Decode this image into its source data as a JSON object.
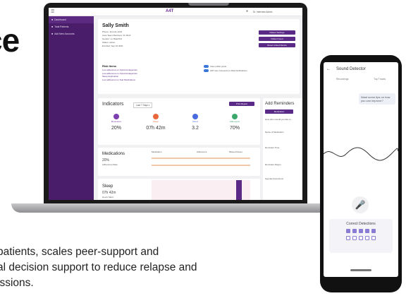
{
  "hero": {
    "text": "ce"
  },
  "tagline": {
    "line1": "patients, scales peer-support and",
    "line2": "al decision support to reduce relapse and",
    "line3": "issions."
  },
  "laptop": {
    "app_logo": "A4T",
    "user_label": "Dr. Interview Admin",
    "sidebar": {
      "items": [
        {
          "label": "Dashboard",
          "active": true
        },
        {
          "label": "Total Patients",
          "active": false
        },
        {
          "label": "Add New Accounts",
          "active": false
        }
      ]
    },
    "patient": {
      "name": "Sally Smith",
      "phone": "Phone: 111-111-1234",
      "care_team": "Care Team Members: Dr. Beth",
      "gender": "Gender: no Male/N/A",
      "status": "Status: active",
      "enrolled": "Enrolled: Sep 16 2021"
    },
    "actions": [
      "Patient Settings",
      "Patient Feed",
      "Reset Linked Device"
    ],
    "risk": {
      "title": "Risk Items",
      "items": [
        "Low adherence to Opioid Antagonists",
        "Low adherence to Opioid Antagonists",
        "Sleep deprivation",
        "Low adherence to Teal Medications"
      ]
    },
    "toggles": [
      {
        "label": "View public posts",
        "on": true
      },
      {
        "label": "AW User Consents to Risk Notifications",
        "on": true
      }
    ],
    "indicators": {
      "title": "Indicators",
      "range": "Last 7 Days",
      "print": "Print Report",
      "metrics": [
        {
          "label": "Medication",
          "value": "20%",
          "color": "#7b3fb0"
        },
        {
          "label": "Sleep",
          "value": "07h 42m",
          "color": "#e8683a"
        },
        {
          "label": "Mood",
          "value": "3.2",
          "color": "#4a6be0"
        },
        {
          "label": "Adherence",
          "value": "70%",
          "color": "#3aa86a"
        }
      ]
    },
    "medications": {
      "title": "Medications",
      "value": "20%",
      "sub": "Adherence Rate",
      "headers": [
        "Medication",
        "Adherence",
        "Missed Doses"
      ]
    },
    "sleep": {
      "title": "Sleep",
      "value": "07h 42m",
      "sub": "Hours Slept"
    },
    "reminders": {
      "title": "Add Reminders",
      "tab": "Medication",
      "fields": [
        "How often would you like to...",
        "Name of Medication",
        "Reminder Time",
        "Reminder Day(s)",
        "Special Instructions"
      ]
    }
  },
  "phone": {
    "title": "Sound Detector",
    "tabs": [
      "Recordings",
      "Top Tracks"
    ],
    "bubble": "Want some tips on how you can improve?",
    "detections_label": "Correct Detections",
    "detections": [
      true,
      true,
      true,
      true,
      true,
      false,
      false,
      false,
      false,
      false
    ]
  }
}
